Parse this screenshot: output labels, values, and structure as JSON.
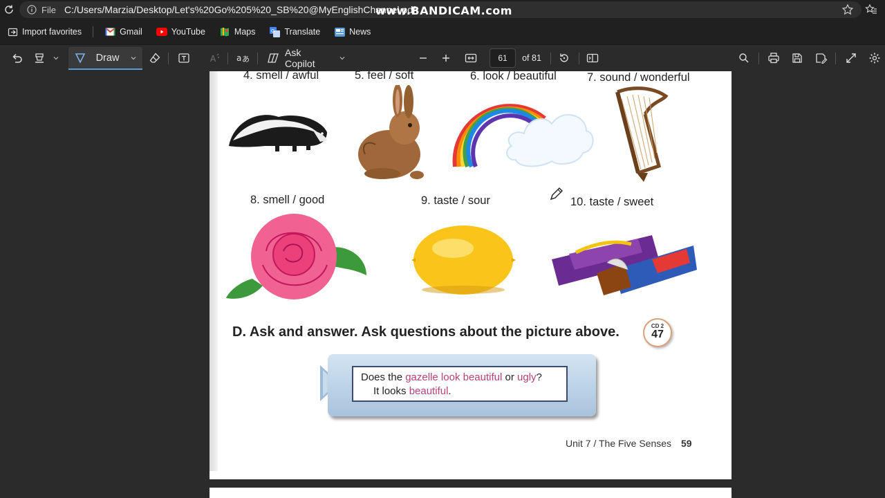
{
  "browser": {
    "file_label": "File",
    "url": "C:/Users/Marzia/Desktop/Let's%20Go%205%20_SB%20@MyEnglishChannel.pdf",
    "watermark": "www.BANDICAM.com"
  },
  "favorites": [
    {
      "label": "Import favorites",
      "icon": "import-icon"
    },
    {
      "label": "Gmail",
      "icon": "gmail-icon"
    },
    {
      "label": "YouTube",
      "icon": "youtube-icon"
    },
    {
      "label": "Maps",
      "icon": "maps-icon"
    },
    {
      "label": "Translate",
      "icon": "translate-icon"
    },
    {
      "label": "News",
      "icon": "news-icon"
    }
  ],
  "toolbar": {
    "draw_label": "Draw",
    "copilot_label": "Ask Copilot",
    "page_number": "61",
    "page_total": "of 81"
  },
  "page": {
    "items_row1": [
      "4. smell / awful",
      "5. feel / soft",
      "6. look / beautiful",
      "7. sound / wonderful"
    ],
    "items_row2": [
      "8. smell / good",
      "9. taste / sour",
      "10. taste / sweet"
    ],
    "heading": "D. Ask and answer. Ask questions about the picture above.",
    "cd_label": "CD 2",
    "cd_number": "47",
    "question": {
      "p1": "Does the ",
      "p2": "gazelle look beautiful",
      "p3": " or ",
      "p4": "ugly",
      "p5": "?"
    },
    "answer": {
      "p1": "It looks ",
      "p2": "beautiful",
      "p3": "."
    },
    "footer_unit": "Unit 7  /  The Five Senses",
    "footer_page": "59"
  },
  "colors": {
    "accent": "#5b9bd5",
    "pink_text": "#b5407a"
  }
}
